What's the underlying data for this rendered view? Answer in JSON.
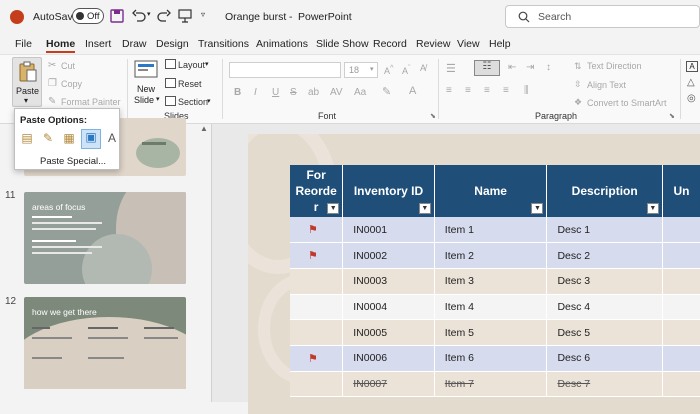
{
  "titlebar": {
    "autosave_label": "AutoSave",
    "toggle_label": "Off",
    "doc_title": "Orange burst",
    "separator": "-",
    "app_name": "PowerPoint",
    "search_placeholder": "Search"
  },
  "tabs": [
    "File",
    "Home",
    "Insert",
    "Draw",
    "Design",
    "Transitions",
    "Animations",
    "Slide Show",
    "Record",
    "Review",
    "View",
    "Help"
  ],
  "active_tab": "Home",
  "clipboard": {
    "paste": "Paste",
    "cut": "Cut",
    "copy": "Copy",
    "format_painter": "Format Painter"
  },
  "slides_group": {
    "new_slide_line1": "New",
    "new_slide_line2": "Slide",
    "layout": "Layout",
    "reset": "Reset",
    "section": "Section",
    "label": "Slides"
  },
  "font_group": {
    "font_size": "18",
    "label": "Font",
    "bold": "B",
    "italic": "I",
    "underline": "U",
    "strike": "S"
  },
  "paragraph_group": {
    "text_direction": "Text Direction",
    "align_text": "Align Text",
    "convert_smartart": "Convert to SmartArt",
    "label": "Paragraph"
  },
  "paste_menu": {
    "title": "Paste Options:",
    "special": "Paste Special..."
  },
  "slides": [
    {
      "number": "11",
      "title": "areas of focus"
    },
    {
      "number": "12",
      "title": "how we get there"
    }
  ],
  "table": {
    "headers": [
      "For Reorde r",
      "Inventory ID",
      "Name",
      "Description",
      "Un"
    ],
    "header_lines": [
      [
        "For",
        "Reorde",
        "r"
      ],
      [
        "Inventory ID"
      ],
      [
        "Name"
      ],
      [
        "Description"
      ],
      [
        "Un"
      ]
    ],
    "rows": [
      {
        "flag": true,
        "id": "IN0001",
        "name": "Item 1",
        "desc": "Desc 1",
        "strike": false
      },
      {
        "flag": true,
        "id": "IN0002",
        "name": "Item 2",
        "desc": "Desc 2",
        "strike": false
      },
      {
        "flag": false,
        "id": "IN0003",
        "name": "Item 3",
        "desc": "Desc 3",
        "strike": false
      },
      {
        "flag": false,
        "id": "IN0004",
        "name": "Item 4",
        "desc": "Desc 4",
        "strike": false
      },
      {
        "flag": false,
        "id": "IN0005",
        "name": "Item 5",
        "desc": "Desc 5",
        "strike": false
      },
      {
        "flag": true,
        "id": "IN0006",
        "name": "Item 6",
        "desc": "Desc 6",
        "strike": false
      },
      {
        "flag": false,
        "id": "IN0007",
        "name": "Item 7",
        "desc": "Desc 7",
        "strike": true
      }
    ]
  },
  "colors": {
    "accent": "#c43e1c",
    "table_header": "#1f4e79",
    "row_blue": "#d6dbee",
    "row_beige": "#ece3d8",
    "row_white": "#f4f4f4",
    "flag": "#c0392b",
    "slide_bg": "#e4dbcf",
    "thumb_gray": "#8f9a95",
    "thumb_green": "#7e8b7c"
  }
}
